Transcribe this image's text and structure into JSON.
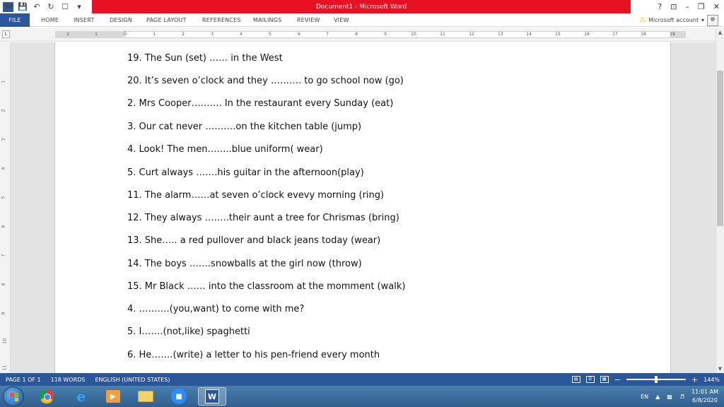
{
  "titlebar": {
    "title": "Document1 - Microsoft Word",
    "quick_access_icons": [
      "word-logo-icon",
      "save-icon",
      "undo-icon",
      "redo-icon",
      "touch-mode-icon"
    ],
    "controls": {
      "help": "?",
      "ribbon_display": "⊡",
      "minimize": "–",
      "restore": "❐",
      "close": "✕"
    }
  },
  "ribbon": {
    "tabs": [
      "FILE",
      "HOME",
      "INSERT",
      "DESIGN",
      "PAGE LAYOUT",
      "REFERENCES",
      "MAILINGS",
      "REVIEW",
      "VIEW"
    ],
    "account_label": "Microsoft account",
    "account_caret": "▾"
  },
  "ruler": {
    "corner": "L",
    "numbers": [
      "2",
      "1",
      "1",
      "2",
      "3",
      "4",
      "5",
      "6",
      "7",
      "8",
      "9",
      "10",
      "11",
      "12",
      "13",
      "14",
      "15",
      "16",
      "17",
      "18",
      "19"
    ],
    "vertical_numbers": [
      "1",
      "2",
      "3",
      "4",
      "5",
      "6",
      "7",
      "8",
      "9",
      "10",
      "11"
    ]
  },
  "document": {
    "lines": [
      "19. The Sun (set) …… in the West",
      "20. It’s seven o’clock and they ………. to go school now (go)",
      "2. Mrs Cooper………. In the restaurant every Sunday (eat)",
      "3. Our cat never ……….on the kitchen table (jump)",
      "4. Look! The men……..blue uniform( wear)",
      "5. Curt always …….his guitar in the afternoon(play)",
      "11. The alarm……at seven o’clock evevy morning (ring)",
      "12. They always ……..their aunt a tree for Chrismas (bring)",
      "13. She….. a red pullover and black jeans today (wear)",
      "14. The boys …….snowballs at the girl now (throw)",
      "15. Mr Black …… into the classroom at the momment (walk)",
      "4. ……….(you,want) to come with me?",
      "5. I…….(not,like) spaghetti",
      "6. He…….(write) a letter to his pen-friend every month"
    ]
  },
  "statusbar": {
    "page": "PAGE 1 OF 1",
    "words": "118 WORDS",
    "language": "ENGLISH (UNITED STATES)",
    "zoom": "144%",
    "zoom_fraction": 0.5
  },
  "taskbar": {
    "apps": [
      "chrome-icon",
      "internet-explorer-icon",
      "media-player-icon",
      "file-explorer-icon",
      "zoom-icon",
      "word-icon"
    ],
    "tray_lang": "EN",
    "time": "11:01 AM",
    "date": "6/8/2020"
  },
  "colors": {
    "title_red": "#e81123",
    "word_blue": "#2b579a"
  }
}
